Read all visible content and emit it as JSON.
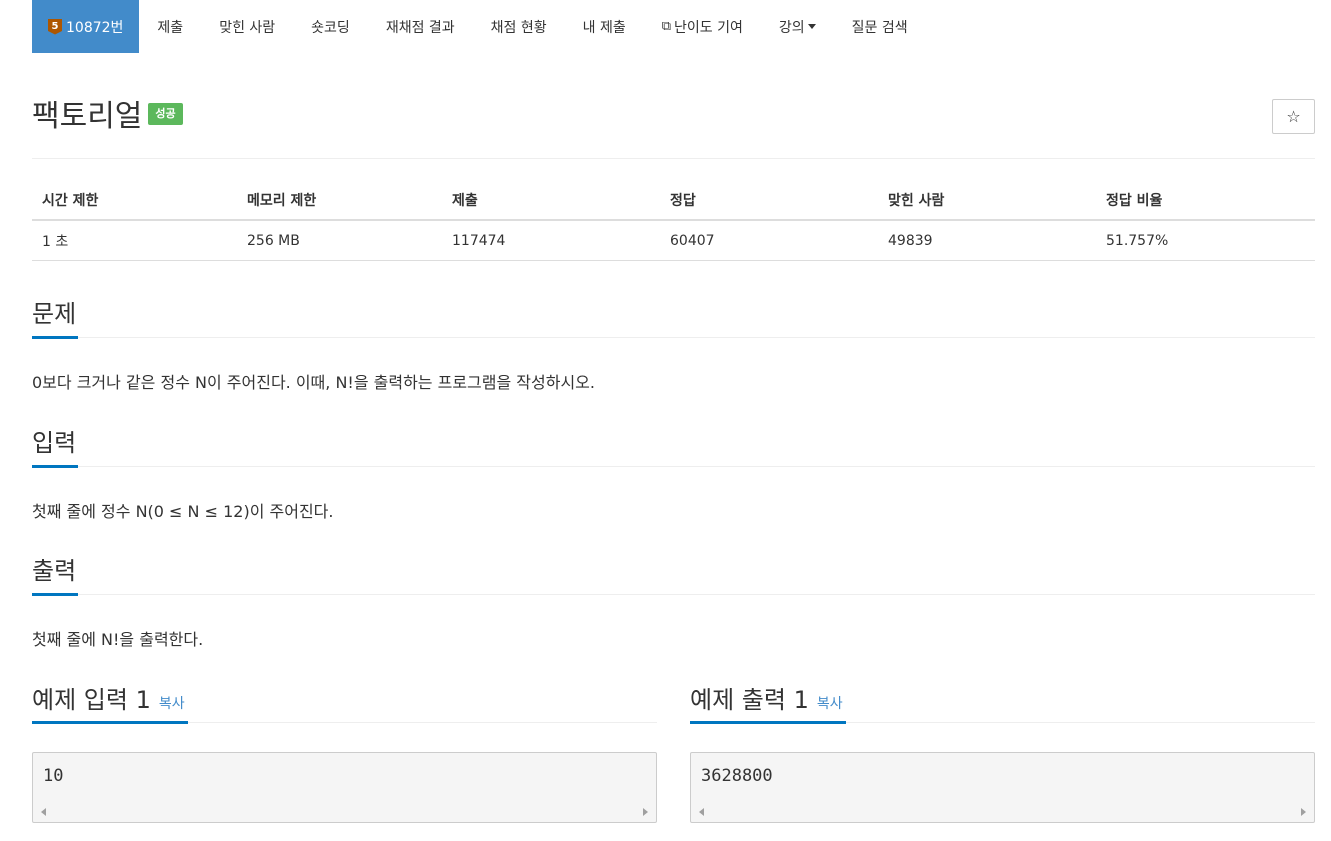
{
  "nav": {
    "problem_tier": "5",
    "problem_number": "10872번",
    "items": [
      "제출",
      "맞힌 사람",
      "숏코딩",
      "재채점 결과",
      "채점 현황",
      "내 제출",
      "난이도 기여",
      "강의",
      "질문 검색"
    ]
  },
  "problem": {
    "title": "팩토리얼",
    "status_badge": "성공",
    "star": "☆"
  },
  "info_table": {
    "headers": [
      "시간 제한",
      "메모리 제한",
      "제출",
      "정답",
      "맞힌 사람",
      "정답 비율"
    ],
    "values": [
      "1 초",
      "256 MB",
      "117474",
      "60407",
      "49839",
      "51.757%"
    ]
  },
  "sections": {
    "description": {
      "title": "문제",
      "text": "0보다 크거나 같은 정수 N이 주어진다. 이때, N!을 출력하는 프로그램을 작성하시오."
    },
    "input": {
      "title": "입력",
      "text": "첫째 줄에 정수 N(0 ≤ N ≤ 12)이 주어진다."
    },
    "output": {
      "title": "출력",
      "text": "첫째 줄에 N!을 출력한다."
    }
  },
  "samples": {
    "input": {
      "title": "예제 입력 1",
      "copy_label": "복사",
      "content": "10"
    },
    "output": {
      "title": "예제 출력 1",
      "copy_label": "복사",
      "content": "3628800"
    }
  },
  "colors": {
    "nav_active": "#428bca",
    "success": "#5cb85c",
    "accent_underline": "#0076c0",
    "tier_bronze": "#ad5600"
  }
}
